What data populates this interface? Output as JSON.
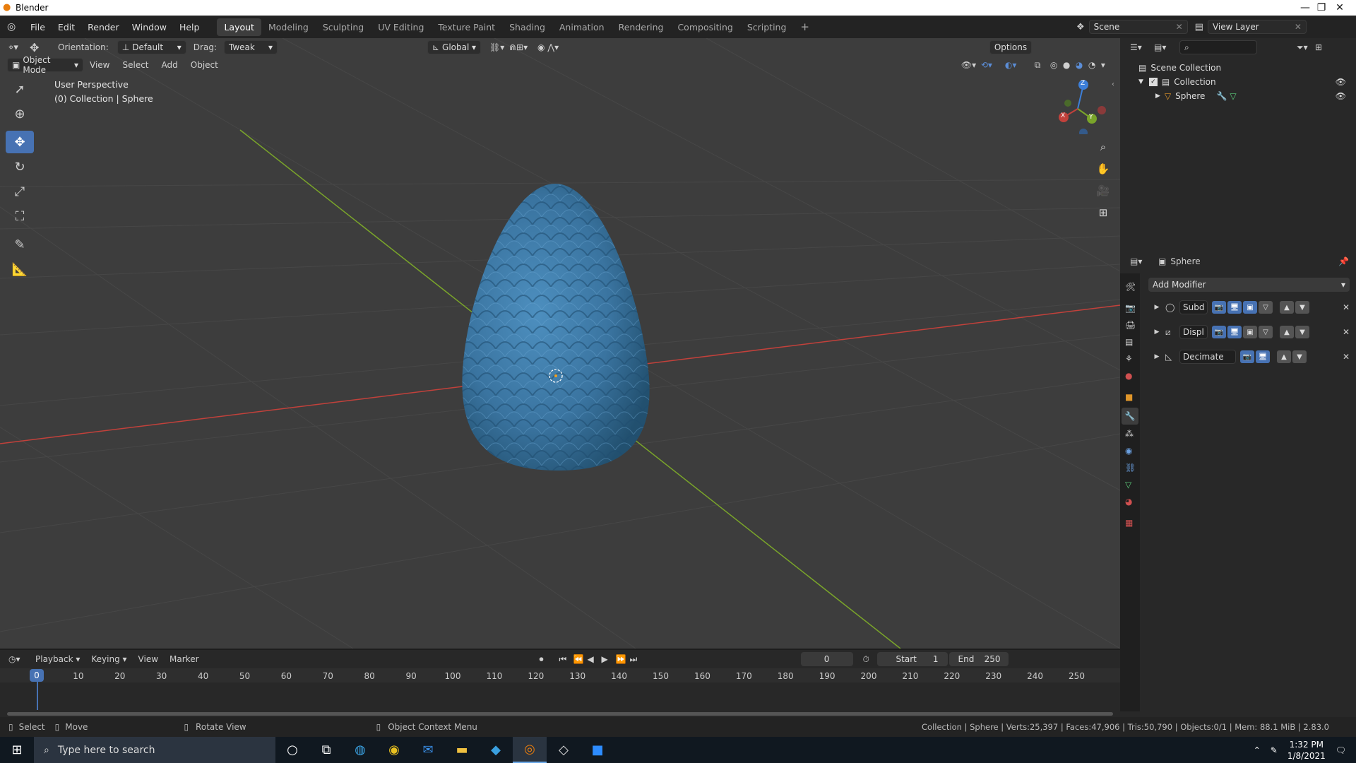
{
  "window": {
    "title": "Blender",
    "minimize": "—",
    "restore": "❐",
    "close": "✕"
  },
  "menu": {
    "items": [
      "File",
      "Edit",
      "Render",
      "Window",
      "Help"
    ]
  },
  "workspaces": {
    "tabs": [
      "Layout",
      "Modeling",
      "Sculpting",
      "UV Editing",
      "Texture Paint",
      "Shading",
      "Animation",
      "Rendering",
      "Compositing",
      "Scripting"
    ],
    "active": "Layout",
    "add": "+"
  },
  "scene": {
    "name": "Scene",
    "view_layer": "View Layer"
  },
  "viewport_header": {
    "orientation_label": "Orientation:",
    "orientation_value": "Default",
    "drag_label": "Drag:",
    "drag_value": "Tweak",
    "transform_orientation": "Global",
    "options": "Options",
    "mode": "Object Mode",
    "menus": [
      "View",
      "Select",
      "Add",
      "Object"
    ]
  },
  "viewport": {
    "perspective": "User Perspective",
    "collection_info": "(0) Collection | Sphere"
  },
  "gizmo": {
    "z": "Z",
    "y": "Y",
    "x": "X"
  },
  "outliner": {
    "search_placeholder": "",
    "rows": [
      {
        "label": "Scene Collection"
      },
      {
        "label": "Collection"
      },
      {
        "label": "Sphere"
      }
    ]
  },
  "properties": {
    "object_name": "Sphere",
    "add_modifier": "Add Modifier",
    "modifiers": [
      {
        "name": "Subd"
      },
      {
        "name": "Displ"
      },
      {
        "name": "Decimate"
      }
    ]
  },
  "timeline": {
    "menus": [
      "Playback",
      "Keying",
      "View",
      "Marker"
    ],
    "current_frame": "0",
    "start_label": "Start",
    "start": "1",
    "end_label": "End",
    "end": "250",
    "ticks": [
      "0",
      "10",
      "20",
      "30",
      "40",
      "50",
      "60",
      "70",
      "80",
      "90",
      "100",
      "110",
      "120",
      "130",
      "140",
      "150",
      "160",
      "170",
      "180",
      "190",
      "200",
      "210",
      "220",
      "230",
      "240",
      "250"
    ]
  },
  "status": {
    "select": "Select",
    "move": "Move",
    "rotate": "Rotate View",
    "context": "Object Context Menu",
    "stats": "Collection | Sphere | Verts:25,397 | Faces:47,906 | Tris:50,790 | Objects:0/1 | Mem: 88.1 MiB | 2.83.0"
  },
  "taskbar": {
    "search_placeholder": "Type here to search",
    "time": "1:32 PM",
    "date": "1/8/2021"
  },
  "colors": {
    "accent": "#4772b3",
    "egg": "#3f7fae",
    "x_axis": "#c2413b",
    "y_axis": "#7aa52a",
    "z_axis": "#3d7fd9"
  }
}
